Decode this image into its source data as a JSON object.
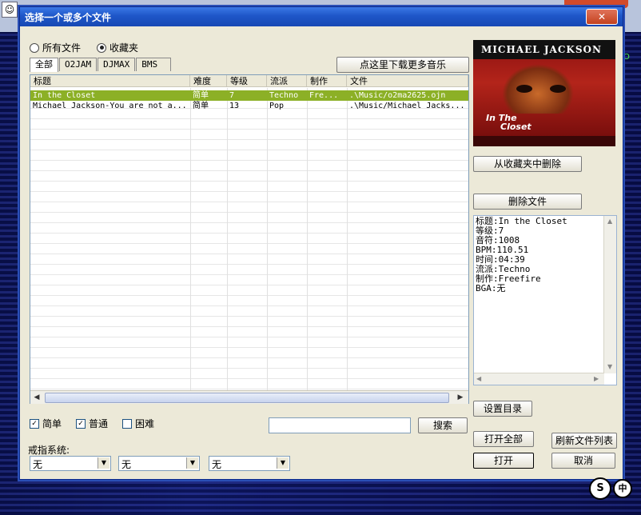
{
  "window": {
    "title": "选择一个或多个文件",
    "close_icon": "close-icon"
  },
  "filter": {
    "all_files": "所有文件",
    "favorites": "收藏夹",
    "selected": "favorites"
  },
  "tabs": [
    "全部",
    "O2JAM",
    "DJMAX",
    "BMS"
  ],
  "download_button": "点这里下载更多音乐",
  "table": {
    "columns": [
      "标题",
      "难度",
      "等级",
      "流派",
      "制作",
      "文件"
    ],
    "rows": [
      {
        "title": "In the Closet",
        "difficulty": "简单",
        "level": "7",
        "genre": "Techno",
        "maker": "Fre...",
        "file": ".\\Music/o2ma2625.ojn",
        "selected": true
      },
      {
        "title": "Michael Jackson-You are not a...",
        "difficulty": "简单",
        "level": "13",
        "genre": "Pop",
        "maker": "",
        "file": ".\\Music/Michael Jacks...",
        "selected": false
      }
    ]
  },
  "difficulty_filters": [
    {
      "label": "简单",
      "checked": true
    },
    {
      "label": "普通",
      "checked": true
    },
    {
      "label": "困难",
      "checked": false
    }
  ],
  "search": {
    "value": "",
    "button": "搜索"
  },
  "ring_system": {
    "label": "戒指系统:",
    "selects": [
      "无",
      "无",
      "无"
    ]
  },
  "cover": {
    "brand": "MICHAEL JACKSON",
    "song_line1": "In The",
    "song_line2": "Closet"
  },
  "actions": {
    "remove_favorite": "从收藏夹中删除",
    "delete_file": "删除文件",
    "set_directory": "设置目录",
    "open_all": "打开全部",
    "refresh": "刷新文件列表",
    "open": "打开",
    "cancel": "取消"
  },
  "info": [
    "标题:In the Closet",
    "等级:7",
    "音符:1008",
    "BPM:110.51",
    "时间:04:39",
    "流派:Techno",
    "制作:Freefire",
    "BGA:无"
  ],
  "colors": {
    "selected_row": "#8cb026",
    "titlebar": "#1e56c8",
    "dialog_bg": "#ece9d8"
  },
  "background": {
    "side_text": "O"
  },
  "tray": [
    "S",
    "中"
  ]
}
